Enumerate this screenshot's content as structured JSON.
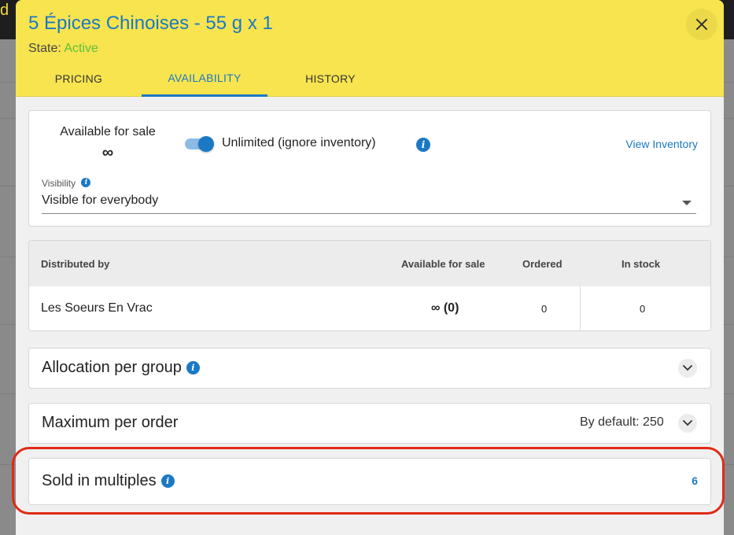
{
  "background": {
    "topbar_glyph": "d"
  },
  "modal": {
    "title": "5 Épices Chinoises - 55 g x 1",
    "state_label": "State:",
    "state_value": "Active",
    "tabs": [
      {
        "label": "PRICING",
        "active": false
      },
      {
        "label": "AVAILABILITY",
        "active": true
      },
      {
        "label": "HISTORY",
        "active": false
      }
    ]
  },
  "availability": {
    "label": "Available for sale",
    "value": "∞",
    "unlimited_toggle_on": true,
    "unlimited_label": "Unlimited (ignore inventory)",
    "view_inventory": "View Inventory",
    "visibility_label": "Visibility",
    "visibility_value": "Visible for everybody"
  },
  "distribution_table": {
    "headers": [
      "Distributed by",
      "Available for sale",
      "Ordered",
      "In stock"
    ],
    "rows": [
      [
        "Les Soeurs En Vrac",
        "∞ (0)",
        "0",
        "0"
      ]
    ]
  },
  "allocation": {
    "title": "Allocation per group"
  },
  "max_per_order": {
    "title": "Maximum per order",
    "default_text": "By default: 250"
  },
  "sold_in_multiples": {
    "title": "Sold in multiples",
    "value": "6"
  },
  "colors": {
    "header_bg": "#f7e44f",
    "accent": "#1b79c4",
    "active_state": "#5bbf3b",
    "highlight": "#e02a16"
  }
}
